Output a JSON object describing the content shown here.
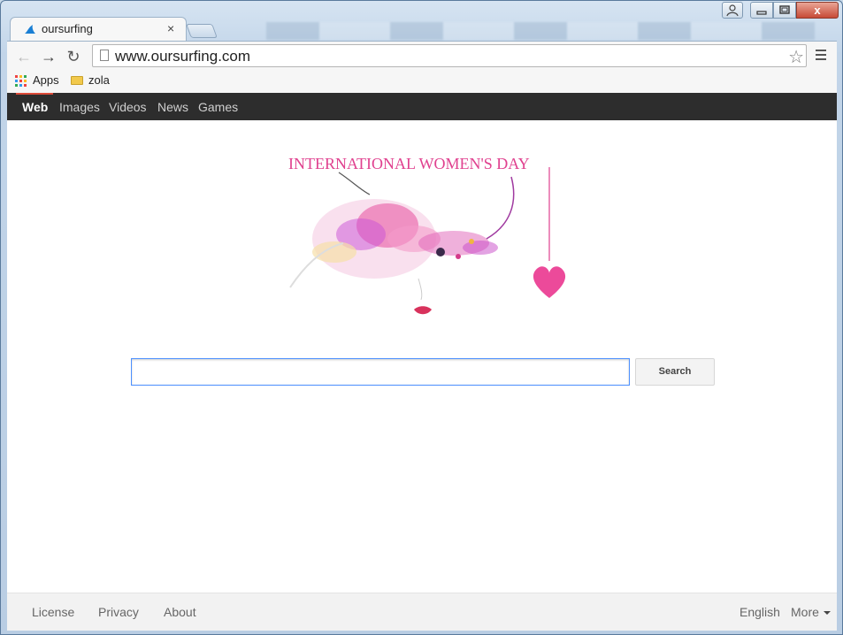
{
  "browser": {
    "tab_title": "oursurfing",
    "tab_close": "×",
    "url": "www.oursurfing.com",
    "window_close": "x",
    "bookmarks": [
      {
        "label": "Apps"
      },
      {
        "label": "zola"
      }
    ]
  },
  "site": {
    "nav": [
      {
        "label": "Web",
        "active": true
      },
      {
        "label": "Images"
      },
      {
        "label": "Videos"
      },
      {
        "label": "News"
      },
      {
        "label": "Games"
      }
    ],
    "doodle_text": "INTERNATIONAL WOMEN'S DAY",
    "search": {
      "value": "",
      "button_label": "Search"
    },
    "footer": {
      "links": [
        "License",
        "Privacy",
        "About"
      ],
      "language": "English",
      "more": "More"
    }
  },
  "colors": {
    "navbar_bg": "#2d2d2d",
    "doodle_pink": "#e0418f",
    "search_focus": "#4d90fe"
  }
}
